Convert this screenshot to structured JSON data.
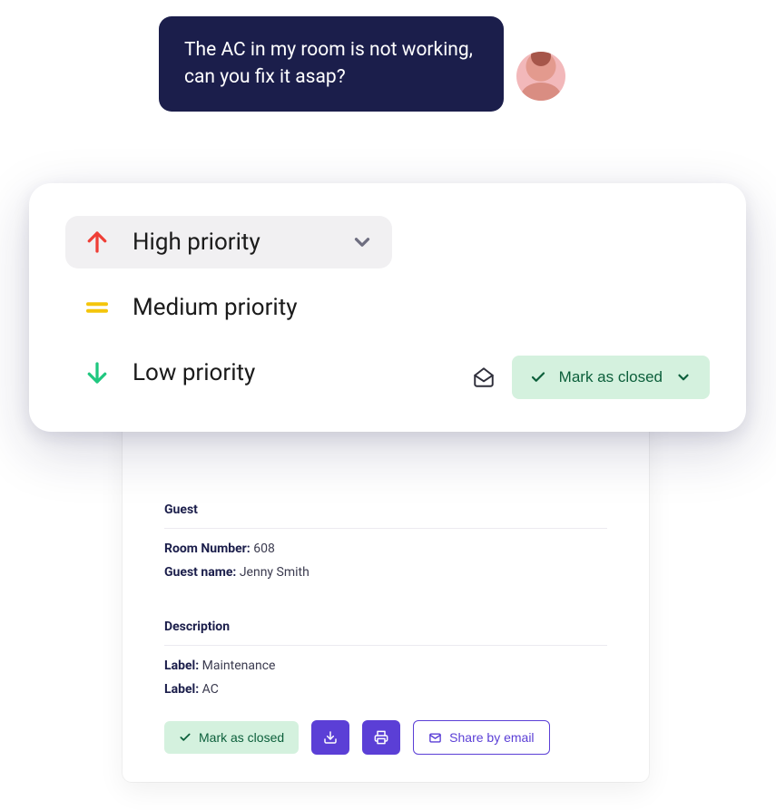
{
  "chat": {
    "message": "The AC in my room is not working, can you fix it asap?"
  },
  "priority": {
    "options": [
      {
        "label": "High priority"
      },
      {
        "label": "Medium priority"
      },
      {
        "label": "Low priority"
      }
    ],
    "selected_index": 0,
    "mark_closed_label": "Mark as closed"
  },
  "detail": {
    "guest_section_title": "Guest",
    "room_number_label": "Room Number:",
    "room_number_value": "608",
    "guest_name_label": "Guest name:",
    "guest_name_value": "Jenny Smith",
    "description_section_title": "Description",
    "labels": [
      {
        "key": "Label:",
        "value": "Maintenance"
      },
      {
        "key": "Label:",
        "value": "AC"
      }
    ],
    "actions": {
      "mark_closed": "Mark as closed",
      "share_by_email": "Share by email"
    }
  }
}
